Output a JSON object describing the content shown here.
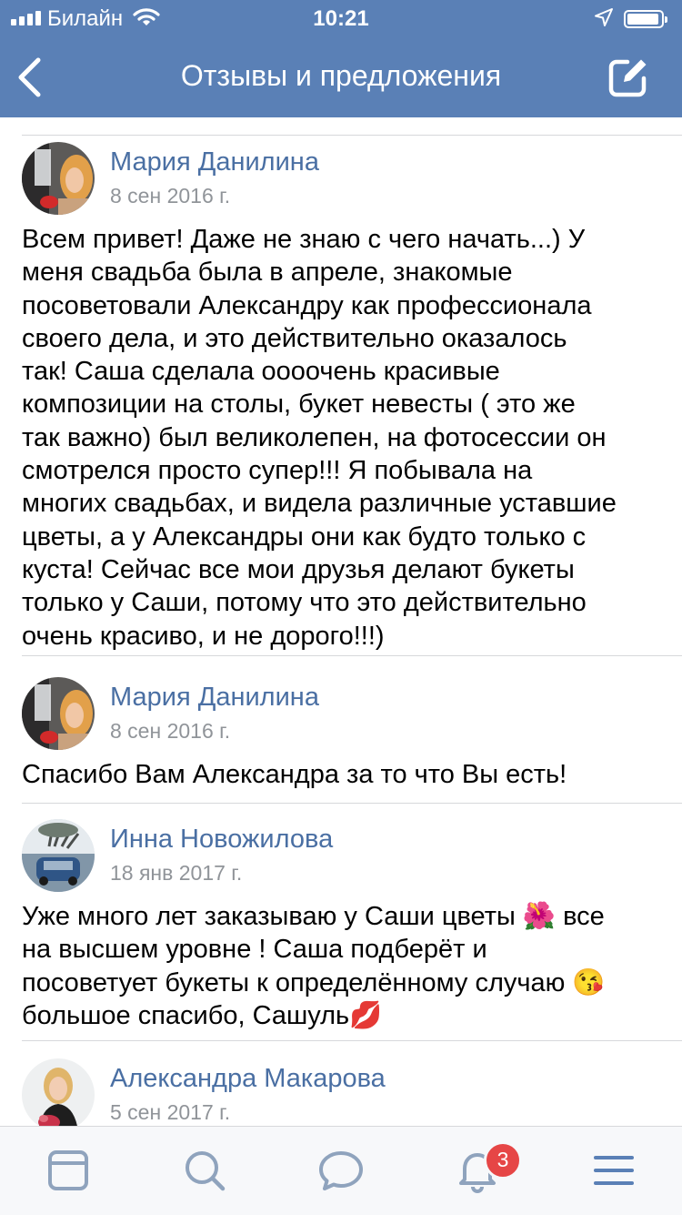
{
  "status_bar": {
    "carrier": "Билайн",
    "time": "10:21"
  },
  "nav": {
    "title": "Отзывы и предложения"
  },
  "posts": [
    {
      "author": "Мария Данилина",
      "date": "8 сен 2016 г.",
      "lines": [
        "Всем привет! Даже не знаю с чего начать...) У",
        "меня свадьба была в апреле, знакомые",
        "посоветовали Александру как профессионала",
        "своего дела, и это действительно оказалось",
        "так! Саша сделала оооочень красивые",
        "композиции на столы, букет невесты ( это же",
        "так важно) был великолепен, на фотосессии он",
        "смотрелся просто супер!!! Я побывала на",
        "многих свадьбах, и видела различные уставшие",
        "цветы, а у Александры они как будто только с",
        "куста! Сейчас все мои друзья делают букеты",
        "только у Саши, потому что это действительно",
        "очень красиво, и не дорого!!!)"
      ]
    },
    {
      "author": "Мария Данилина",
      "date": "8 сен 2016 г.",
      "lines": [
        "Спасибо Вам Александра за то что Вы есть!"
      ]
    },
    {
      "author": "Инна Новожилова",
      "date": "18 янв 2017 г.",
      "lines": [
        "Уже много лет заказываю у Саши цветы 🌺 все",
        "на высшем уровне ! Саша подберёт и",
        "посоветует букеты к определённому случаю 😘",
        "большое спасибо, Сашуль💋"
      ]
    },
    {
      "author": "Александра Макарова",
      "date": "5 сен 2017 г."
    }
  ],
  "tabbar": {
    "notifications_badge": "3"
  },
  "colors": {
    "header_bg": "#5a80b6",
    "author_link": "#4a6fa3",
    "meta_gray": "#909499",
    "tab_icon": "#8fa3bd",
    "badge": "#e64646"
  }
}
